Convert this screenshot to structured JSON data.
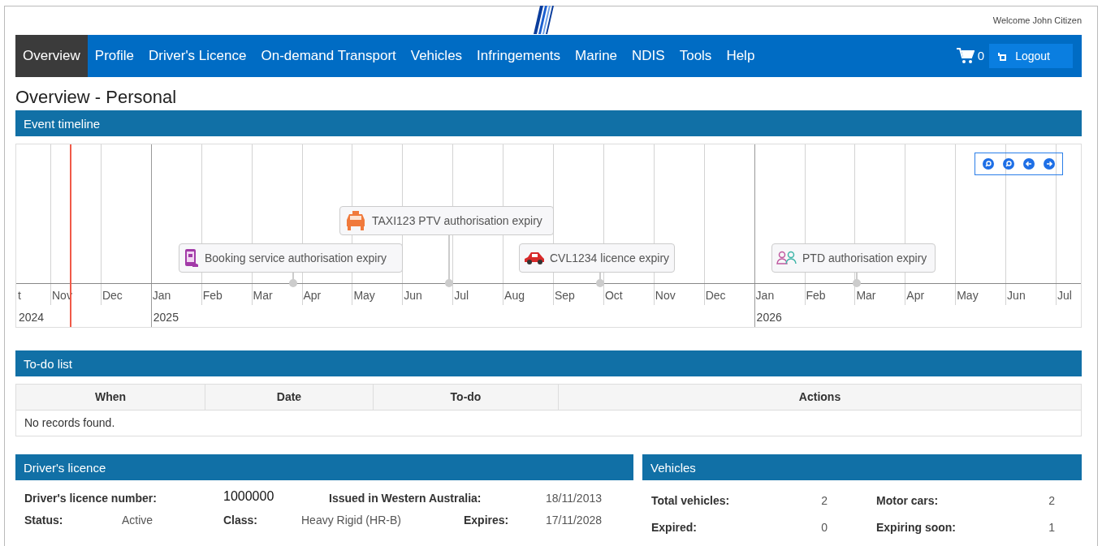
{
  "header": {
    "welcome": "Welcome John Citizen"
  },
  "nav": {
    "items": [
      {
        "label": "Overview",
        "selected": true
      },
      {
        "label": "Profile",
        "selected": false
      },
      {
        "label": "Driver's Licence",
        "selected": false
      },
      {
        "label": "On-demand Transport",
        "selected": false
      },
      {
        "label": "Vehicles",
        "selected": false
      },
      {
        "label": "Infringements",
        "selected": false
      },
      {
        "label": "Marine",
        "selected": false
      },
      {
        "label": "NDIS",
        "selected": false
      },
      {
        "label": "Tools",
        "selected": false
      },
      {
        "label": "Help",
        "selected": false
      }
    ],
    "cart_count": "0",
    "logout": "Logout"
  },
  "page_title": "Overview - Personal",
  "timeline": {
    "title": "Event timeline",
    "months": [
      "t",
      "Nov",
      "Dec",
      "Jan",
      "Feb",
      "Mar",
      "Apr",
      "May",
      "Jun",
      "Jul",
      "Aug",
      "Sep",
      "Oct",
      "Nov",
      "Dec",
      "Jan",
      "Feb",
      "Mar",
      "Apr",
      "May",
      "Jun",
      "Jul"
    ],
    "years": [
      "2024",
      "2025",
      "2026"
    ],
    "events": [
      {
        "label": "Booking service authorisation expiry",
        "kind": "booking"
      },
      {
        "label": "TAXI123 PTV authorisation expiry",
        "kind": "taxi"
      },
      {
        "label": "CVL1234 licence expiry",
        "kind": "car"
      },
      {
        "label": "PTD authorisation expiry",
        "kind": "people"
      }
    ]
  },
  "todo": {
    "title": "To-do list",
    "columns": [
      "When",
      "Date",
      "To-do",
      "Actions"
    ],
    "empty": "No records found."
  },
  "licence": {
    "title": "Driver's licence",
    "number_label": "Driver's licence number:",
    "number": "1000000",
    "issued_label": "Issued in Western Australia:",
    "issued": "18/11/2013",
    "status_label": "Status:",
    "status": "Active",
    "class_label": "Class:",
    "class": "Heavy Rigid (HR-B)",
    "expires_label": "Expires:",
    "expires": "17/11/2028"
  },
  "vehicles": {
    "title": "Vehicles",
    "stats": [
      {
        "label": "Total vehicles:",
        "value": "2"
      },
      {
        "label": "Motor cars:",
        "value": "2"
      },
      {
        "label": "Expired:",
        "value": "0"
      },
      {
        "label": "Expiring soon:",
        "value": "1"
      }
    ]
  }
}
